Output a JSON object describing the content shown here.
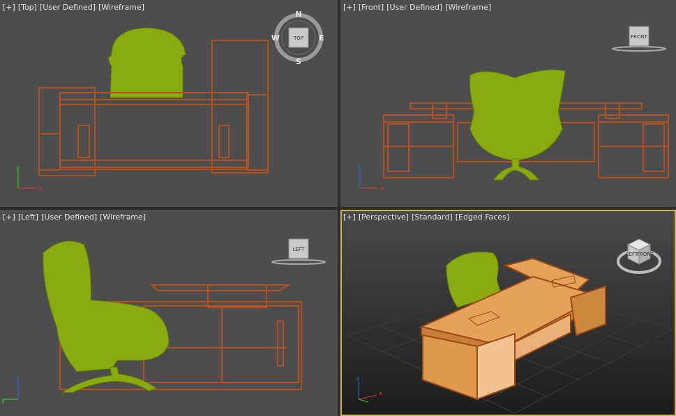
{
  "viewports": {
    "top": {
      "label_parts": [
        "[+]",
        "[Top]",
        "[User Defined]",
        "[Wireframe]"
      ],
      "viewcube_face": "TOP",
      "compass": {
        "n": "N",
        "s": "S",
        "e": "E",
        "w": "W"
      }
    },
    "front": {
      "label_parts": [
        "[+]",
        "[Front]",
        "[User Defined]",
        "[Wireframe]"
      ],
      "viewcube_face": "FRONT"
    },
    "left": {
      "label_parts": [
        "[+]",
        "[Left]",
        "[User Defined]",
        "[Wireframe]"
      ],
      "viewcube_face": "LEFT"
    },
    "perspective": {
      "label_parts": [
        "[+]",
        "[Perspective]",
        "[Standard]",
        "[Edged Faces]"
      ],
      "viewcube_face_left": "LEFT",
      "viewcube_face_front": "FRONT",
      "active": true
    }
  },
  "axis_labels": {
    "x": "x",
    "y": "y",
    "z": "z"
  },
  "colors": {
    "viewport_bg": "#4d4d4d",
    "wire_desk": "#b3501f",
    "wire_chair": "#8aaa10",
    "active_border": "#c8b44a",
    "desk_shaded": "#e09a4a"
  }
}
